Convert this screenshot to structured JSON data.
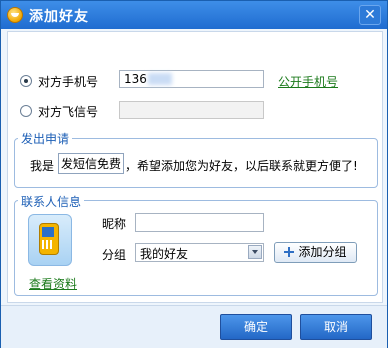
{
  "window": {
    "title": "添加好友",
    "close_symbol": "✕"
  },
  "form": {
    "radio_phone_label": "对方手机号",
    "phone_value": "136",
    "public_phone_link": "公开手机号",
    "radio_fetion_label": "对方飞信号",
    "fetion_value": ""
  },
  "request": {
    "title": "发出申请",
    "prefix": "我是",
    "sender_value": "发短信免费",
    "suffix": "，希望添加您为好友，以后联系就更方便了!"
  },
  "contact": {
    "title": "联系人信息",
    "view_profile_link": "查看资料",
    "nickname_label": "昵称",
    "nickname_value": "",
    "group_label": "分组",
    "group_value": "我的好友",
    "add_group_button": "添加分组"
  },
  "footer": {
    "ok_button": "确定",
    "cancel_button": "取消"
  }
}
